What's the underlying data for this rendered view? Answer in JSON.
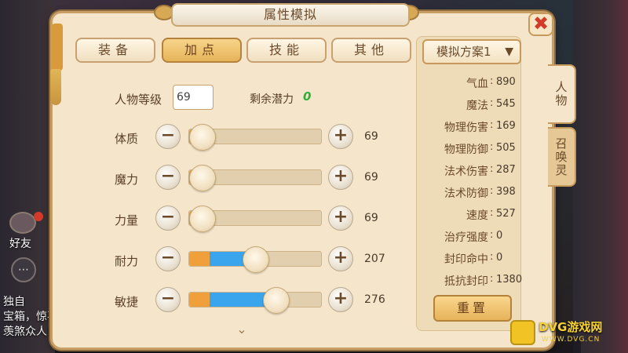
{
  "window": {
    "title": "属性模拟",
    "close_icon": "close-icon"
  },
  "tabs": [
    {
      "label": "装备",
      "active": false
    },
    {
      "label": "加点",
      "active": true
    },
    {
      "label": "技能",
      "active": false
    },
    {
      "label": "其他",
      "active": false
    }
  ],
  "level": {
    "label": "人物等级",
    "value": "69"
  },
  "remaining": {
    "label": "剩余潜力",
    "value": "0"
  },
  "attributes": [
    {
      "label": "体质",
      "value": "69",
      "fill_orange": 0.1,
      "fill_blue": 0.0,
      "knob": 0.1
    },
    {
      "label": "魔力",
      "value": "69",
      "fill_orange": 0.1,
      "fill_blue": 0.0,
      "knob": 0.1
    },
    {
      "label": "力量",
      "value": "69",
      "fill_orange": 0.1,
      "fill_blue": 0.0,
      "knob": 0.1
    },
    {
      "label": "耐力",
      "value": "207",
      "fill_orange": 0.15,
      "fill_blue": 0.35,
      "knob": 0.5
    },
    {
      "label": "敏捷",
      "value": "276",
      "fill_orange": 0.15,
      "fill_blue": 0.5,
      "knob": 0.65
    }
  ],
  "plan": {
    "label": "模拟方案1",
    "chevron_icon": "chevron-down-icon"
  },
  "stats": [
    {
      "label": "气血",
      "value": "890"
    },
    {
      "label": "魔法",
      "value": "545"
    },
    {
      "label": "物理伤害",
      "value": "169"
    },
    {
      "label": "物理防御",
      "value": "505"
    },
    {
      "label": "法术伤害",
      "value": "287"
    },
    {
      "label": "法术防御",
      "value": "398"
    },
    {
      "label": "速度",
      "value": "527"
    },
    {
      "label": "治疗强度",
      "value": "0"
    },
    {
      "label": "封印命中",
      "value": "0"
    },
    {
      "label": "抵抗封印",
      "value": "1380"
    }
  ],
  "reset_label": "重置",
  "side_tabs": [
    {
      "label": "人物",
      "active": true
    },
    {
      "label": "召唤灵",
      "active": false
    }
  ],
  "background": {
    "friend_label": "好友",
    "chat_lines": [
      "独自",
      "宝箱，惊喜",
      "羡煞众人!"
    ]
  },
  "logo": {
    "text": "DVG游戏网",
    "sub": "WWW.DVG.CN"
  },
  "colors": {
    "accent_orange": "#f0a03a",
    "accent_blue": "#3aa4ec",
    "close_red": "#d23a2a",
    "remaining_green": "#2fb036"
  }
}
